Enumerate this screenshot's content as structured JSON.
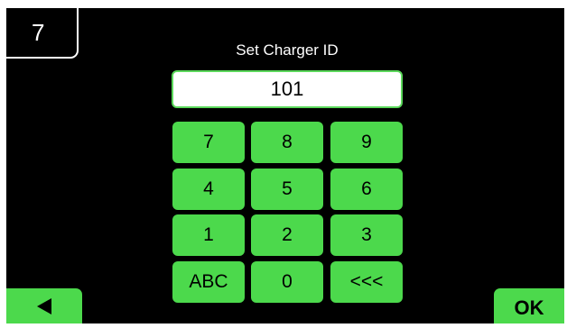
{
  "header": {
    "screen_number": "7",
    "title": "Set Charger ID"
  },
  "id_field": {
    "value": "101"
  },
  "keypad": {
    "k7": "7",
    "k8": "8",
    "k9": "9",
    "k4": "4",
    "k5": "5",
    "k6": "6",
    "k1": "1",
    "k2": "2",
    "k3": "3",
    "abc": "ABC",
    "k0": "0",
    "backspace": "<<<"
  },
  "footer": {
    "back_icon": "left-triangle-icon",
    "ok_label": "OK"
  },
  "colors": {
    "background": "#000000",
    "key_green": "#4cd94c",
    "field_border": "#5bd85b",
    "frame": "#ffffff"
  }
}
